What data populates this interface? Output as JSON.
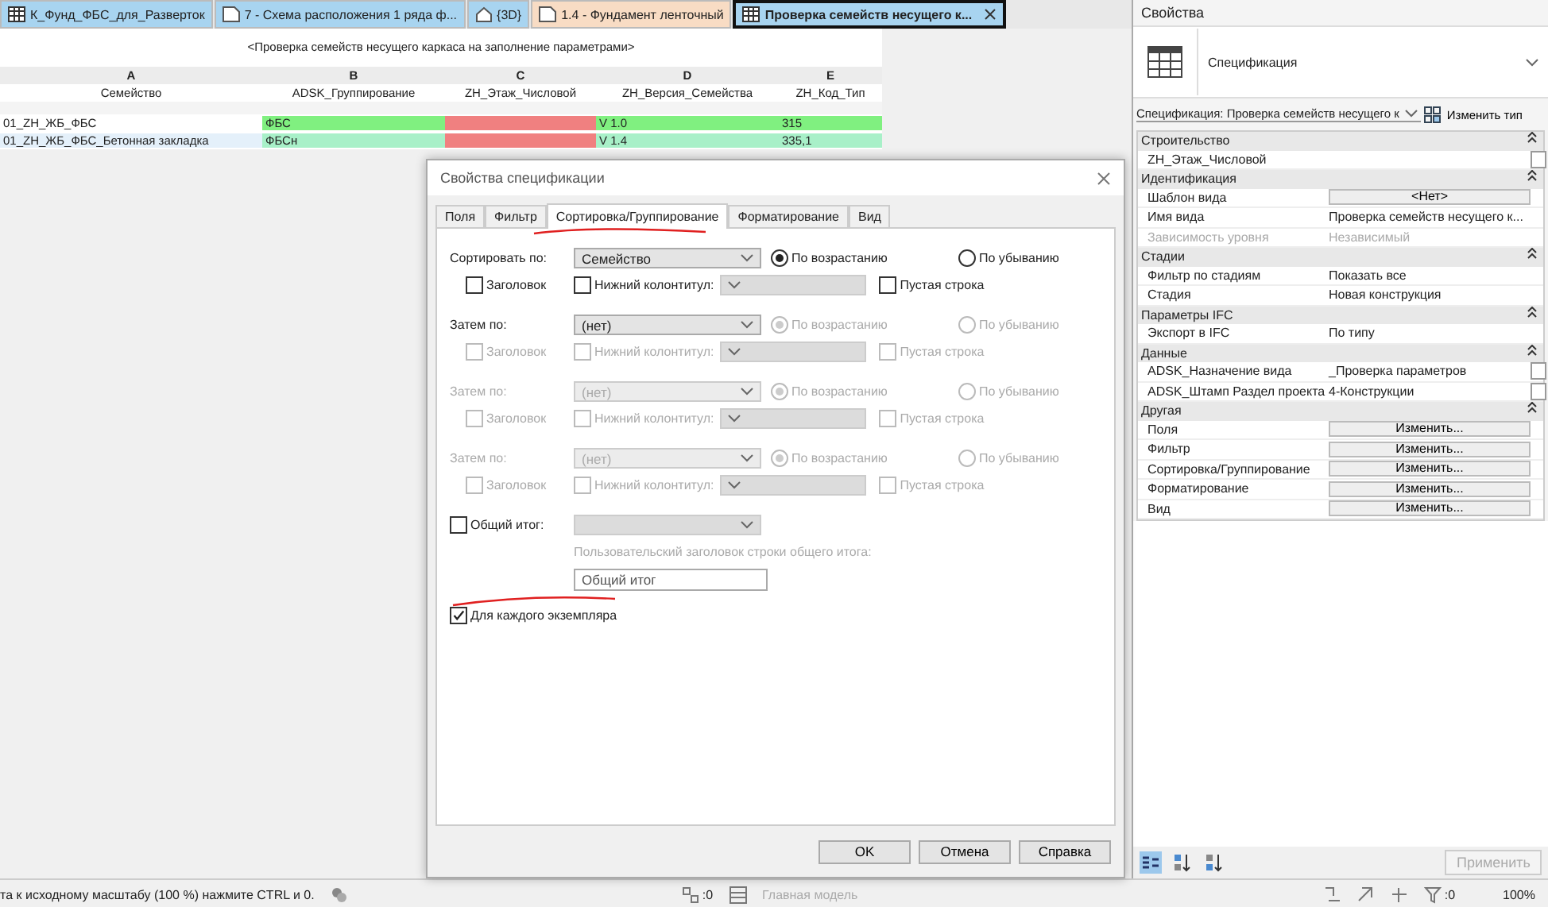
{
  "tabs": [
    {
      "label": "К_Фунд_ФБС_для_Разверток",
      "kind": "schedule",
      "color": "#a8d4f0",
      "selected": false,
      "closable": false
    },
    {
      "label": "7 - Схема расположения 1 ряда ф...",
      "kind": "sheet",
      "color": "#a8d4f0",
      "selected": false,
      "closable": false
    },
    {
      "label": "{3D}",
      "kind": "house",
      "color": "#a8d4f0",
      "selected": false,
      "closable": false
    },
    {
      "label": "1.4 - Фундамент ленточный",
      "kind": "sheet",
      "color": "#f8dcc4",
      "selected": false,
      "closable": false
    },
    {
      "label": "Проверка семейств несущего к...",
      "kind": "schedule",
      "color": "#a8d4f0",
      "selected": true,
      "closable": true
    }
  ],
  "schedule": {
    "title": "<Проверка семейств несущего каркаса на заполнение параметрами>",
    "columns": [
      {
        "letter": "A",
        "header": "Семейство"
      },
      {
        "letter": "B",
        "header": "ADSK_Группирование"
      },
      {
        "letter": "C",
        "header": "ZH_Этаж_Числовой"
      },
      {
        "letter": "D",
        "header": "ZH_Версия_Семейства"
      },
      {
        "letter": "E",
        "header": "ZH_Код_Тип"
      }
    ],
    "rows": [
      {
        "selected": false,
        "cells": [
          {
            "text": "01_ZH_ЖБ_ФБС"
          },
          {
            "text": "ФБС",
            "color": "#80f080"
          },
          {
            "text": "",
            "color": "#f08080"
          },
          {
            "text": "V 1.0",
            "color": "#80f080"
          },
          {
            "text": "315",
            "color": "#80f080"
          }
        ]
      },
      {
        "selected": true,
        "cells": [
          {
            "text": "01_ZH_ЖБ_ФБС_Бетонная закладка"
          },
          {
            "text": "ФБСн",
            "color": "#a8f0c8"
          },
          {
            "text": "",
            "color": "#f08080"
          },
          {
            "text": "V 1.4",
            "color": "#a8f0c8"
          },
          {
            "text": "335,1",
            "color": "#a8f0c8"
          }
        ]
      }
    ]
  },
  "dialog": {
    "title": "Свойства спецификации",
    "tabs": [
      {
        "label": "Поля",
        "selected": false
      },
      {
        "label": "Фильтр",
        "selected": false
      },
      {
        "label": "Сортировка/Группирование",
        "selected": true
      },
      {
        "label": "Форматирование",
        "selected": false
      },
      {
        "label": "Вид",
        "selected": false
      }
    ],
    "levels": [
      {
        "label": "Сортировать по:",
        "value": "Семейство",
        "disabled": false,
        "options_disabled": false,
        "ascending_label": "По возрастанию",
        "descending_label": "По убыванию",
        "ascending": true,
        "header_label": "Заголовок",
        "header": false,
        "footer_label": "Нижний колонтитул:",
        "footer": false,
        "blank_label": "Пустая строка",
        "blank": false
      },
      {
        "label": "Затем по:",
        "value": "(нет)",
        "disabled": false,
        "options_disabled": true,
        "ascending_label": "По возрастанию",
        "descending_label": "По убыванию",
        "ascending": true,
        "header_label": "Заголовок",
        "header": false,
        "footer_label": "Нижний колонтитул:",
        "footer": false,
        "blank_label": "Пустая строка",
        "blank": false
      },
      {
        "label": "Затем по:",
        "value": "(нет)",
        "disabled": true,
        "options_disabled": true,
        "ascending_label": "По возрастанию",
        "descending_label": "По убыванию",
        "ascending": true,
        "header_label": "Заголовок",
        "header": false,
        "footer_label": "Нижний колонтитул:",
        "footer": false,
        "blank_label": "Пустая строка",
        "blank": false
      },
      {
        "label": "Затем по:",
        "value": "(нет)",
        "disabled": true,
        "options_disabled": true,
        "ascending_label": "По возрастанию",
        "descending_label": "По убыванию",
        "ascending": true,
        "header_label": "Заголовок",
        "header": false,
        "footer_label": "Нижний колонтитул:",
        "footer": false,
        "blank_label": "Пустая строка",
        "blank": false
      }
    ],
    "grand_total": {
      "label": "Общий итог:",
      "checked": false,
      "custom_label": "Пользовательский заголовок строки общего итога:",
      "value": "Общий итог"
    },
    "every_instance": {
      "label": "Для каждого экземпляра",
      "checked": true
    },
    "buttons": [
      "OK",
      "Отмена",
      "Справка"
    ]
  },
  "properties": {
    "title": "Свойства",
    "type": "Спецификация",
    "instance": "Спецификация: Проверка семейств несущего к",
    "edit_type": "Изменить тип",
    "groups": [
      {
        "name": "Строительство",
        "rows": [
          {
            "label": "ZH_Этаж_Числовой",
            "value": "",
            "kind": "check",
            "disabled": false,
            "checked": false
          }
        ]
      },
      {
        "name": "Идентификация",
        "rows": [
          {
            "label": "Шаблон вида",
            "value": "<Нет>",
            "kind": "button",
            "disabled": false
          },
          {
            "label": "Имя вида",
            "value": "Проверка семейств несущего к...",
            "kind": "text",
            "disabled": false
          },
          {
            "label": "Зависимость уровня",
            "value": "Независимый",
            "kind": "text",
            "disabled": true
          }
        ]
      },
      {
        "name": "Стадии",
        "rows": [
          {
            "label": "Фильтр по стадиям",
            "value": "Показать все",
            "kind": "text",
            "disabled": false
          },
          {
            "label": "Стадия",
            "value": "Новая конструкция",
            "kind": "text",
            "disabled": false
          }
        ]
      },
      {
        "name": "Параметры IFC",
        "rows": [
          {
            "label": "Экспорт в IFC",
            "value": "По типу",
            "kind": "text",
            "disabled": false
          }
        ]
      },
      {
        "name": "Данные",
        "rows": [
          {
            "label": "ADSK_Назначение вида",
            "value": "_Проверка параметров",
            "kind": "check",
            "disabled": false,
            "checked": false
          },
          {
            "label": "ADSK_Штамп Раздел проекта",
            "value": "4-Конструкции",
            "kind": "check",
            "disabled": false,
            "checked": false
          }
        ]
      },
      {
        "name": "Другая",
        "rows": [
          {
            "label": "Поля",
            "value": "Изменить...",
            "kind": "button",
            "disabled": false
          },
          {
            "label": "Фильтр",
            "value": "Изменить...",
            "kind": "button",
            "disabled": false
          },
          {
            "label": "Сортировка/Группирование",
            "value": "Изменить...",
            "kind": "button",
            "disabled": false
          },
          {
            "label": "Форматирование",
            "value": "Изменить...",
            "kind": "button",
            "disabled": false
          },
          {
            "label": "Вид",
            "value": "Изменить...",
            "kind": "button",
            "disabled": false
          }
        ]
      }
    ],
    "apply": "Применить",
    "apply_disabled": true
  },
  "status": {
    "hint": "та к исходному масштабу (100 %) нажмите CTRL и 0.",
    "worksets": ":0",
    "model": "Главная модель",
    "filter": ":0",
    "zoom": "100%"
  }
}
